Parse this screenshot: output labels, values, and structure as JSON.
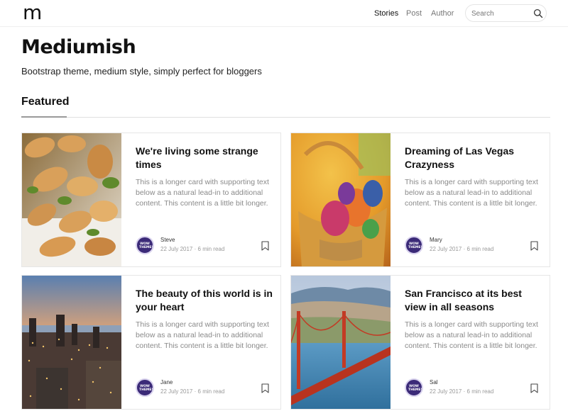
{
  "navbar": {
    "logo": "m",
    "links": [
      "Stories",
      "Post",
      "Author"
    ],
    "search_placeholder": "Search"
  },
  "header": {
    "title": "Mediumish",
    "tagline": "Bootstrap theme, medium style, simply perfect for bloggers"
  },
  "section": {
    "title": "Featured"
  },
  "avatar_text": "WOW THEMES",
  "cards": [
    {
      "title": "We're living some strange times",
      "text": "This is a longer card with supporting text below as a natural lead-in to additional content. This content is a little bit longer.",
      "author": "Steve",
      "date": "22 July 2017",
      "separator": "·",
      "read_time": "6 min read",
      "image": "food-photo"
    },
    {
      "title": "Dreaming of Las Vegas Crazyness",
      "text": "This is a longer card with supporting text below as a natural lead-in to additional content. This content is a little bit longer.",
      "author": "Mary",
      "date": "22 July 2017",
      "separator": "·",
      "read_time": "6 min read",
      "image": "easter-eggs-photo"
    },
    {
      "title": "The beauty of this world is in your heart",
      "text": "This is a longer card with supporting text below as a natural lead-in to additional content. This content is a little bit longer.",
      "author": "Jane",
      "date": "22 July 2017",
      "separator": "·",
      "read_time": "6 min read",
      "image": "city-sunset-photo"
    },
    {
      "title": "San Francisco at its best view in all seasons",
      "text": "This is a longer card with supporting text below as a natural lead-in to additional content. This content is a little bit longer.",
      "author": "Sal",
      "date": "22 July 2017",
      "separator": "·",
      "read_time": "6 min read",
      "image": "golden-gate-photo"
    }
  ],
  "colors": {
    "text": "#111111",
    "muted": "#8a8a8a",
    "border": "#e6e6e6",
    "avatar": "#3b2a78"
  }
}
